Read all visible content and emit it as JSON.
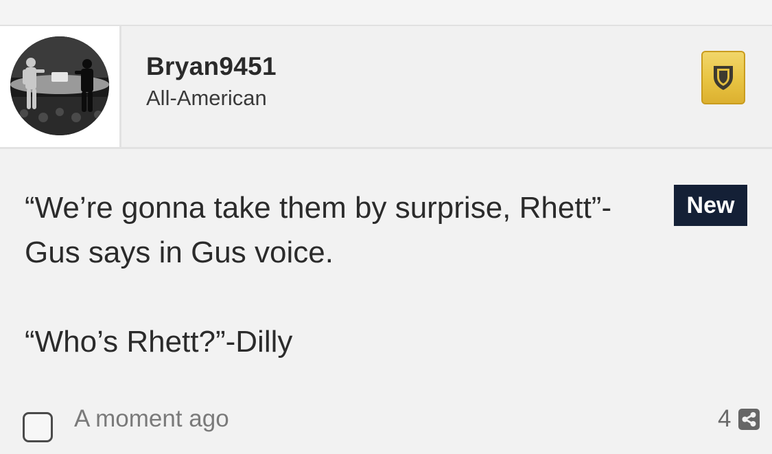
{
  "post": {
    "author": {
      "username": "Bryan9451",
      "rank": "All-American",
      "avatar_icon": "user-avatar-photo",
      "badge_icon": "shield-icon",
      "badge_color": "#e8c442"
    },
    "body": {
      "paragraph_1_line_1": "“We’re gonna take them by surprise, Rhett”-",
      "paragraph_1_line_2": "Gus says in Gus voice.",
      "paragraph_2": "“Who’s Rhett?”-Dilly"
    },
    "new_label": "New",
    "new_label_color": "#142036",
    "footer": {
      "timestamp": "A moment ago",
      "share_count": "4",
      "share_icon": "share-icon"
    }
  }
}
